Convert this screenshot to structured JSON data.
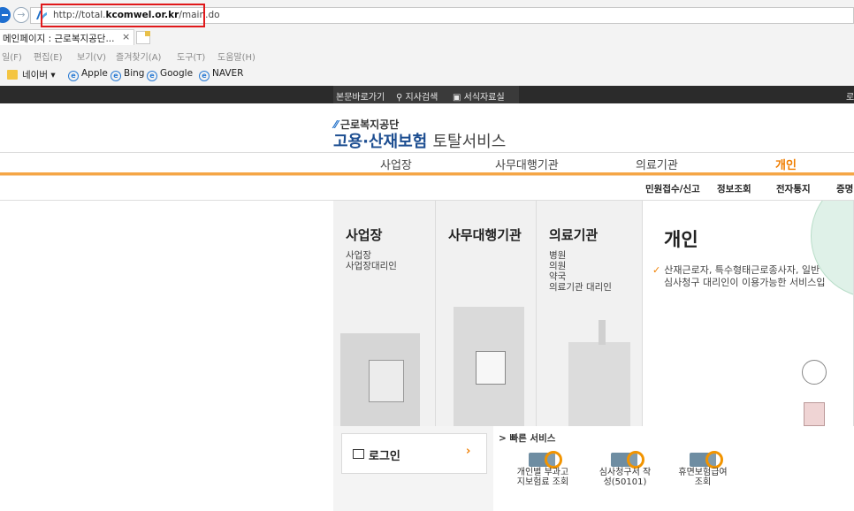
{
  "browser": {
    "url_prefix": "http://total.",
    "url_domain": "kcomwel.or.kr",
    "url_path": "/main.do",
    "tab_title": "메인페이지 : 근로복지공단...",
    "tab_close": "×",
    "menu": [
      "일(F)",
      "편집(E)",
      "보기(V)",
      "즐겨찾기(A)",
      "도구(T)",
      "도움말(H)"
    ],
    "favorites": [
      "네이버 ▾",
      "Apple",
      "Bing",
      "Google",
      "NAVER"
    ]
  },
  "site": {
    "topbar": [
      "본문바로가기",
      "지사검색",
      "서식자료실"
    ],
    "topbar_right": "로",
    "logo_small": "근로복지공단",
    "logo_main": "고용·산재보험",
    "logo_suffix": "토탈서비스",
    "gnb": [
      "사업장",
      "사무대행기관",
      "의료기관",
      "개인"
    ],
    "submenu": [
      "민원접수/신고",
      "정보조회",
      "전자통지",
      "증명"
    ],
    "panels": {
      "biz": {
        "title": "사업장",
        "items": [
          "사업장",
          "사업장대리인"
        ]
      },
      "agency": {
        "title": "사무대행기관",
        "items": []
      },
      "medical": {
        "title": "의료기관",
        "items": [
          "병원",
          "의원",
          "약국",
          "의료기관 대리인"
        ]
      },
      "personal": {
        "title": "개인",
        "desc_line1": "산재근로자, 특수형태근로종사자, 일반",
        "desc_line2": "심사청구 대리인이 이용가능한 서비스입"
      }
    },
    "login": {
      "label": "로그인",
      "arrow": "›"
    },
    "quick": {
      "title": "> 빠른 서비스",
      "items": [
        {
          "line1": "개인별 부과고",
          "line2": "지보험료 조회"
        },
        {
          "line1": "심사청구서 작",
          "line2": "성(50101)"
        },
        {
          "line1": "휴면보험급여",
          "line2": "조회"
        }
      ]
    }
  }
}
